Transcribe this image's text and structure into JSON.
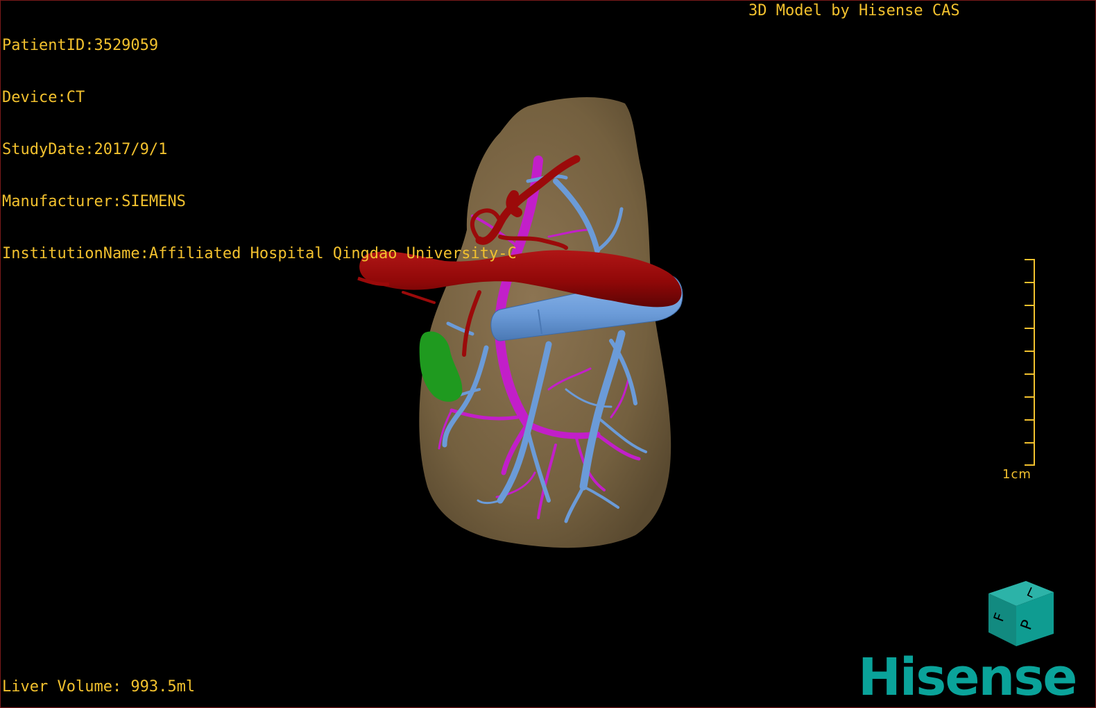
{
  "patient_info": {
    "patient_id": "PatientID:3529059",
    "device": "Device:CT",
    "study_date": "StudyDate:2017/9/1",
    "manufacturer": "Manufacturer:SIEMENS",
    "institution": "InstitutionName:Affiliated Hospital Qingdao University-C"
  },
  "header": {
    "model_credit": "3D Model by Hisense CAS"
  },
  "scale": {
    "label": "1cm"
  },
  "footer": {
    "liver_volume": "Liver Volume: 993.5ml"
  },
  "orientation_cube": {
    "face_front": "F",
    "face_left": "L",
    "face_posterior": "P"
  },
  "brand": {
    "logo_text": "Hisense"
  },
  "colors": {
    "overlay_text": "#f2c12e",
    "liver": "#7a6446",
    "hepatic_artery": "#9b0a0a",
    "hepatic_vein": "#6b9bd8",
    "portal_vein": "#c21fc9",
    "gallbladder": "#1f9a1f",
    "brand_teal": "#0aa39a",
    "border": "#7a1a1a"
  }
}
